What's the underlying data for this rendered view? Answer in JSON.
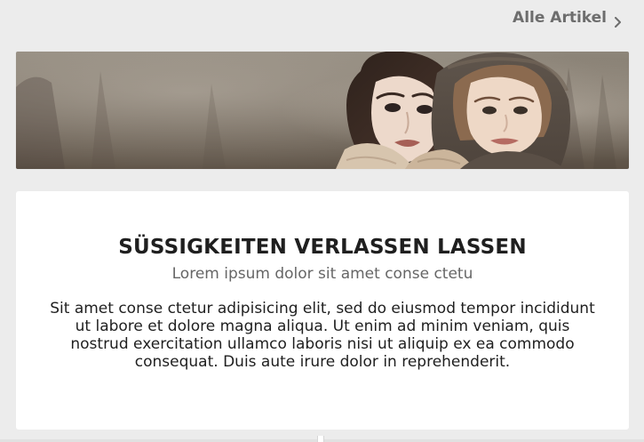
{
  "header": {
    "all_articles_label": "Alle Artikel",
    "all_articles_icon": "chevron-right-icon"
  },
  "banner": {
    "image_label": "Photo of two women in knitted winter clothing",
    "colors": {
      "background_top": "#8c8377",
      "background_bottom": "#625649",
      "sweater": "#d6c3ac",
      "hood": "#5b5148",
      "skin": "#ead7c7"
    }
  },
  "card": {
    "title": "SÜSSIGKEITEN VERLASSEN LASSEN",
    "subtitle": "Lorem ipsum dolor sit amet conse ctetu",
    "body": "Sit amet conse ctetur adipisicing elit, sed do eiusmod tempor incididunt ut labore et dolore magna aliqua. Ut enim ad minim veniam, quis nostrud exercitation ullamco laboris nisi ut aliquip ex ea commodo consequat. Duis aute irure dolor in reprehenderit."
  },
  "theme": {
    "page_background": "#ececec",
    "card_background": "#ffffff",
    "link_color": "#6d6d6d",
    "title_color": "#1f1f1f",
    "subtitle_color": "#666666"
  }
}
